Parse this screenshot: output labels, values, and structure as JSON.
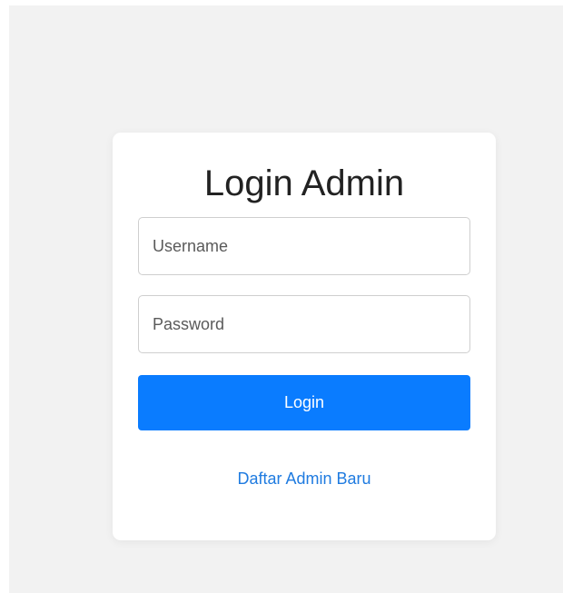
{
  "page": {
    "background": "#f2f2f2"
  },
  "login": {
    "title": "Login Admin",
    "username_placeholder": "Username",
    "username_value": "",
    "password_placeholder": "Password",
    "password_value": "",
    "submit_label": "Login",
    "register_link_label": "Daftar Admin Baru"
  },
  "colors": {
    "primary": "#0a7cff",
    "link": "#1f7be0",
    "card": "#ffffff"
  }
}
